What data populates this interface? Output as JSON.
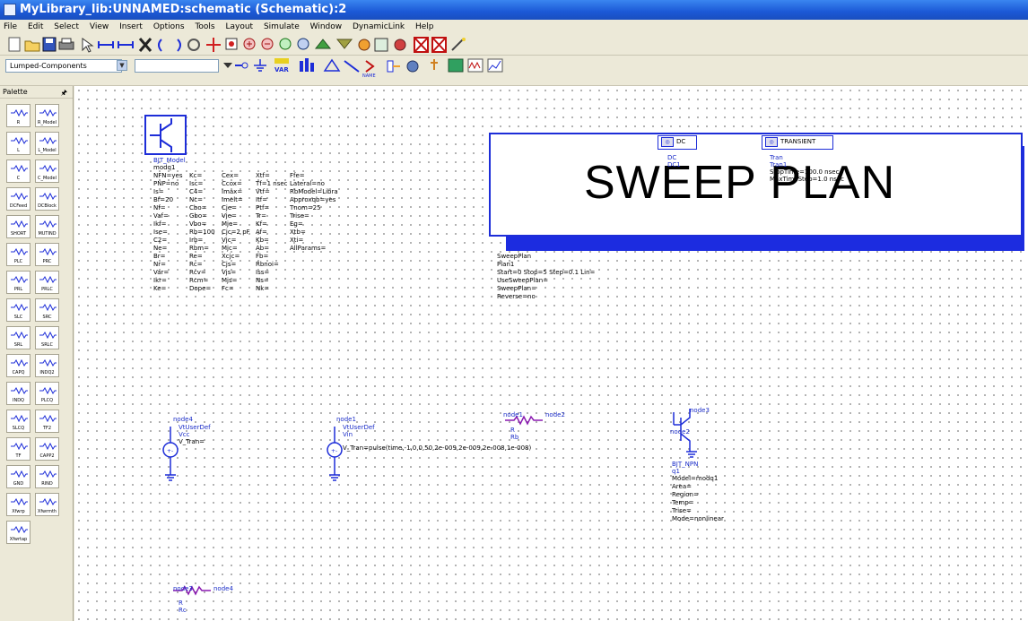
{
  "window": {
    "title": "MyLibrary_lib:UNNAMED:schematic (Schematic):2"
  },
  "menu": [
    "File",
    "Edit",
    "Select",
    "View",
    "Insert",
    "Options",
    "Tools",
    "Layout",
    "Simulate",
    "Window",
    "DynamicLink",
    "Help"
  ],
  "toolbar": {
    "library_select": "Lumped-Components",
    "var_label": "VAR",
    "name_label": "NAME"
  },
  "palette": {
    "title": "Palette",
    "items": [
      "R",
      "R_Model",
      "L",
      "L_Model",
      "C",
      "C_Model",
      "DCFeed",
      "DCBlock",
      "SHORT",
      "MUTIND",
      "PLC",
      "PRC",
      "PRL",
      "PRLC",
      "SLC",
      "SRC",
      "SRL",
      "SRLC",
      "CAPQ",
      "INDQ2",
      "INDQ",
      "PLCQ",
      "SLCQ",
      "TF2",
      "TF",
      "CAPP2",
      "GND",
      "RIND",
      "Xfwrp",
      "Xfwrmth",
      "Xfwrtap"
    ]
  },
  "bjt_model": {
    "name": "BJT_Model",
    "instance": "modq1",
    "col1": [
      "NFN=yes",
      "PNP=no",
      "Is=",
      "Bf=20",
      "Nf=",
      "Vaf=",
      "Ikf=",
      "Ise=",
      "C2=",
      "Ne=",
      "Br=",
      "Nr=",
      "Var=",
      "Ikr=",
      "Ke="
    ],
    "col2": [
      "Kc=",
      "Isc=",
      "C4=",
      "Nc=",
      "Cbo=",
      "Gbo=",
      "Vbo=",
      "Rb=100",
      "Irb=",
      "Rbm=",
      "Re=",
      "Rc=",
      "Rcv=",
      "Rcm=",
      "Dope="
    ],
    "col3": [
      "Cex=",
      "Ccox=",
      "Imax=",
      "Imelt=",
      "Cje=",
      "Vje=",
      "Mje=",
      "Cjc=2 pF",
      "Vjc=",
      "Mjc=",
      "Xcjc=",
      "Cjs=",
      "Vjs=",
      "Mjs=",
      "Fc="
    ],
    "col4": [
      "Xtf=",
      "Tf=1 nsec",
      "Vtf=",
      "Itf=",
      "Ptf=",
      "Tr=",
      "Kf=",
      "Af=",
      "Kb=",
      "Ab=",
      "Fb=",
      "Rbnoi=",
      "Iss=",
      "Ns=",
      "Nk="
    ],
    "col5": [
      "Ffe=",
      "Lateral=no",
      "RbModel=Libra",
      "Approxqb=yes",
      "Tnom=25",
      "Trise=",
      "Eg=",
      "Xtb=",
      "Xti=",
      "AllParams="
    ]
  },
  "sweep_plan": {
    "big_label": "SWEEP PLAN",
    "dc_label": "DC",
    "dc_sub1": "DC",
    "dc_sub2": "DC1",
    "tran_label": "TRANSIENT",
    "tran_sub1": "Tran",
    "tran_sub2": "Tran1",
    "tran_sub3": "StopTime=100.0 nsec",
    "tran_sub4": "MaxTimeStep=1.0 nsec",
    "info": [
      "SweepPlan",
      "Plan1",
      "Start=0 Stop=5 Step=0.1 Lin=",
      "UseSweepPlan=",
      "SweepPlan=",
      "Reverse=no"
    ]
  },
  "source_vcc": {
    "node": "node4",
    "type": "VtUserDef",
    "name": "Vcc",
    "value": "V_Tran="
  },
  "source_vin": {
    "node": "node1",
    "type": "VtUserDef",
    "name": "Vin",
    "value": "V_Tran=pulse(time,-1,0,0,50,2e-009,2e-009,2e-008,1e-008)"
  },
  "resistor_rb": {
    "node_a": "node1",
    "node_b": "node2",
    "type": "R",
    "name": "Rb"
  },
  "bjt_q1": {
    "node_c": "node3",
    "node_b": "node2",
    "type": "BJT_NPN",
    "name": "q1",
    "params": [
      "Model=modq1",
      "Area=",
      "Region=",
      "Temp=",
      "Trise=",
      "Mode=nonlinear"
    ]
  },
  "resistor_rc": {
    "node_a": "node3",
    "node_b": "node4",
    "type": "R",
    "name": "Rc"
  }
}
